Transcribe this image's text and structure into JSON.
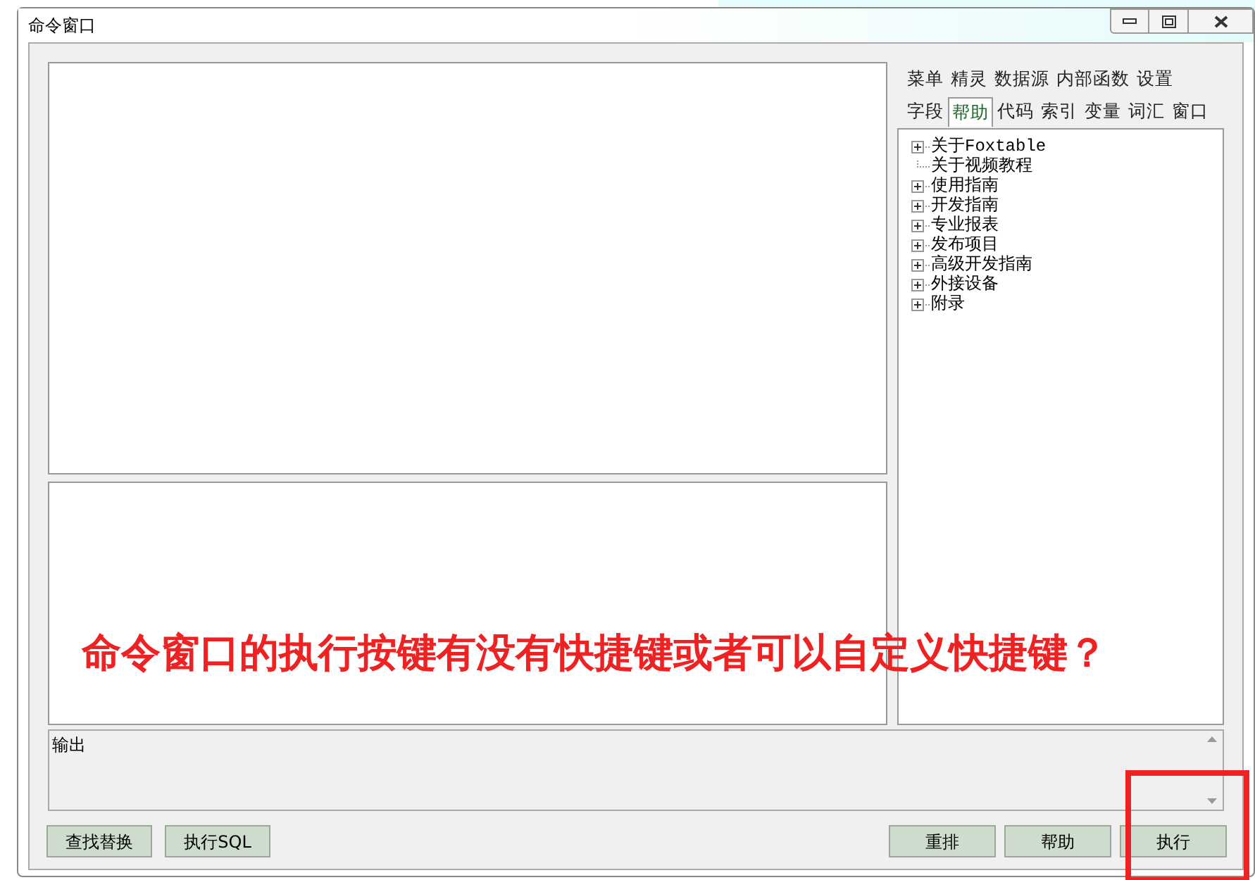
{
  "window": {
    "title": "命令窗口"
  },
  "tab_rows": [
    [
      {
        "label": "菜单",
        "selected": false
      },
      {
        "label": "精灵",
        "selected": false
      },
      {
        "label": "数据源",
        "selected": false
      },
      {
        "label": "内部函数",
        "selected": false
      },
      {
        "label": "设置",
        "selected": false
      }
    ],
    [
      {
        "label": "字段",
        "selected": false
      },
      {
        "label": "帮助",
        "selected": true
      },
      {
        "label": "代码",
        "selected": false
      },
      {
        "label": "索引",
        "selected": false
      },
      {
        "label": "变量",
        "selected": false
      },
      {
        "label": "词汇",
        "selected": false
      },
      {
        "label": "窗口",
        "selected": false
      }
    ]
  ],
  "help_tree": [
    {
      "label": "关于Foxtable",
      "expandable": true
    },
    {
      "label": "关于视频教程",
      "expandable": false
    },
    {
      "label": "使用指南",
      "expandable": true
    },
    {
      "label": "开发指南",
      "expandable": true
    },
    {
      "label": "专业报表",
      "expandable": true
    },
    {
      "label": "发布项目",
      "expandable": true
    },
    {
      "label": "高级开发指南",
      "expandable": true
    },
    {
      "label": "外接设备",
      "expandable": true
    },
    {
      "label": "附录",
      "expandable": true
    }
  ],
  "output": {
    "label": "输出"
  },
  "left_buttons": [
    "查找替换",
    "执行SQL"
  ],
  "right_buttons": [
    "重排",
    "帮助",
    "执行"
  ],
  "annotation": {
    "text": "命令窗口的执行按键有没有快捷键或者可以自定义快捷键？"
  }
}
